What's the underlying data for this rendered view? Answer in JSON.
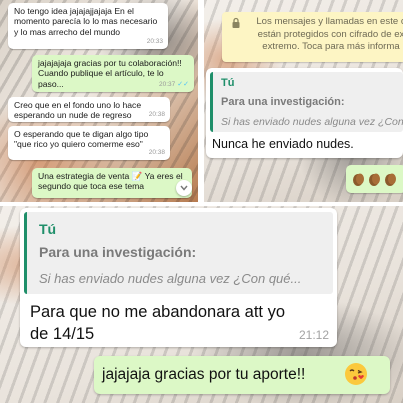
{
  "panel1": {
    "messages": [
      {
        "dir": "in",
        "text": "No tengo idea jajajajjajaja En el momento parecía lo lo mas necesario y lo mas arrecho del mundo",
        "time": "20:33"
      },
      {
        "dir": "out",
        "text": "jajajajaja gracias por tu colaboración!! Cuando publique el artículo, te lo paso...",
        "time": "20:37"
      },
      {
        "dir": "in",
        "text": "Creo que en el fondo uno lo hace esperando un nude de regreso",
        "time": "20:38"
      },
      {
        "dir": "in",
        "text": "O esperando que te digan algo tipo \"que rico yo quiero comerme eso\"",
        "time": "20:38"
      },
      {
        "dir": "out",
        "text": "Una estrategia de venta",
        "text_after": " Ya eres el segundo que toca ese tema",
        "time": ""
      }
    ]
  },
  "panel2": {
    "notice": "Los mensajes y llamadas en este c... están protegidos con cifrado de ext... extremo. Toca para más informa...",
    "notice_line1": "Los mensajes y llamadas en este c",
    "notice_line2": "están protegidos con cifrado de ex",
    "notice_line3": "extremo. Toca para más informa",
    "reply": {
      "quoted_name": "Tú",
      "quoted_title": "Para una investigación:",
      "quoted_text": "Si has enviado nudes alguna vez ¿Con q",
      "text": "Nunca he enviado nudes."
    }
  },
  "panel3": {
    "reply": {
      "quoted_name": "Tú",
      "quoted_title": "Para una investigación:",
      "quoted_text": "Si has enviado nudes alguna vez ¿Con qué...",
      "text_line1": "Para que no me abandonara att yo",
      "text_line2": "de 14/15",
      "time": "21:12"
    },
    "outgoing": "jajajaja gracias por tu aporte!!"
  },
  "colors": {
    "outgoing_bubble": "#dcf8c6",
    "incoming_bubble": "#ffffff",
    "quote_accent": "#1f8f6a",
    "read_ticks": "#4fc3f7",
    "notice_bg": "#fdf5c4"
  },
  "icons": [
    "double-check-icon",
    "pencil-memo-emoji",
    "chevron-down-icon",
    "lock-icon",
    "clapping-hands-emoji",
    "kiss-face-emoji"
  ]
}
